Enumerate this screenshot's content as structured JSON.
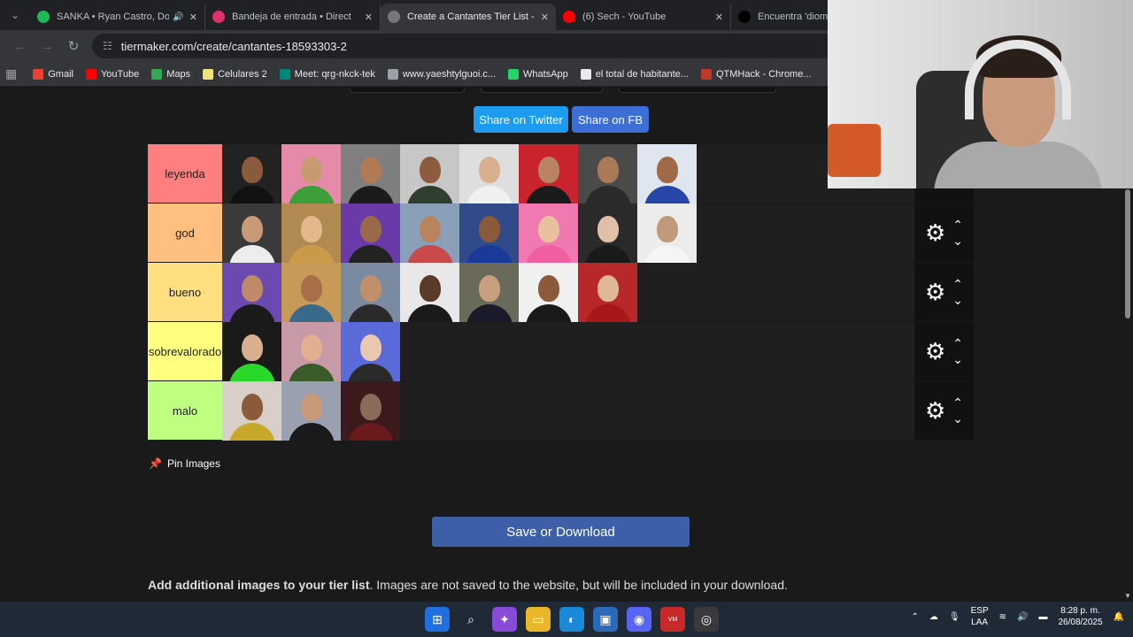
{
  "tabs": [
    {
      "title": "SANKA • Ryan Castro, Don",
      "favicon_color": "#1db954",
      "audio": true,
      "active": false
    },
    {
      "title": "Bandeja de entrada • Direct",
      "favicon_color": "#e1306c",
      "audio": false,
      "active": false
    },
    {
      "title": "Create a Cantantes Tier List - Ti",
      "favicon_color": "#777777",
      "audio": false,
      "active": true
    },
    {
      "title": "(6) Sech - YouTube",
      "favicon_color": "#ff0000",
      "audio": false,
      "active": false
    },
    {
      "title": "Encuentra 'diomed",
      "favicon_color": "#000000",
      "audio": false,
      "active": false
    }
  ],
  "address": {
    "url": "tiermaker.com/create/cantantes-18593303-2"
  },
  "bookmarks": [
    {
      "label": "Gmail",
      "color": "#ea4335"
    },
    {
      "label": "YouTube",
      "color": "#ff0000"
    },
    {
      "label": "Maps",
      "color": "#34a853"
    },
    {
      "label": "Celulares 2",
      "color": "#f1e27a"
    },
    {
      "label": "Meet: qrg-nkck-tek",
      "color": "#00897b"
    },
    {
      "label": "www.yaeshtylguoi.c...",
      "color": "#9aa0a6"
    },
    {
      "label": "WhatsApp",
      "color": "#25d366"
    },
    {
      "label": "el total de habitante...",
      "color": "#e8eaed"
    },
    {
      "label": "QTMHack - Chrome...",
      "color": "#c0392b"
    }
  ],
  "share": {
    "twitter": "Share on Twitter",
    "facebook": "Share on FB"
  },
  "tiers": [
    {
      "label": "leyenda",
      "color": "#ff7f7f",
      "items": [
        {
          "bg": "#222222",
          "skin": "#8a5a3c",
          "shirt": "#111111"
        },
        {
          "bg": "#e58aa8",
          "skin": "#c89a70",
          "shirt": "#3c9f3a"
        },
        {
          "bg": "#7f7f7f",
          "skin": "#b07a55",
          "shirt": "#1b1b1b"
        },
        {
          "bg": "#c7c7c7",
          "skin": "#8d5c3e",
          "shirt": "#2f3f2f"
        },
        {
          "bg": "#dedede",
          "skin": "#d8b090",
          "shirt": "#f0f0f0"
        },
        {
          "bg": "#c9242d",
          "skin": "#b98462",
          "shirt": "#1a1a1a"
        },
        {
          "bg": "#4a4a4a",
          "skin": "#a87a58",
          "shirt": "#2a2a2a"
        },
        {
          "bg": "#dfe6f0",
          "skin": "#a06a48",
          "shirt": "#2845a8"
        }
      ]
    },
    {
      "label": "god",
      "color": "#ffbf7f",
      "items": [
        {
          "bg": "#3a3a3a",
          "skin": "#c89a78",
          "shirt": "#ededed"
        },
        {
          "bg": "#b08a50",
          "skin": "#e3b98c",
          "shirt": "#c89a4a"
        },
        {
          "bg": "#6a3aa8",
          "skin": "#9a6a48",
          "shirt": "#222222"
        },
        {
          "bg": "#8aa0b8",
          "skin": "#b8845e",
          "shirt": "#c84a4a"
        },
        {
          "bg": "#304a8a",
          "skin": "#8a5a3a",
          "shirt": "#1a3a9a"
        },
        {
          "bg": "#f07ab0",
          "skin": "#e8c0a0",
          "shirt": "#f060a0"
        },
        {
          "bg": "#2a2a2a",
          "skin": "#e0c0a8",
          "shirt": "#1a1a1a"
        },
        {
          "bg": "#ececec",
          "skin": "#c09a7a",
          "shirt": "#f5f5f5"
        }
      ]
    },
    {
      "label": "bueno",
      "color": "#ffdf7f",
      "items": [
        {
          "bg": "#6a4ab0",
          "skin": "#c08a68",
          "shirt": "#1a1a1a"
        },
        {
          "bg": "#c89a58",
          "skin": "#a87048",
          "shirt": "#3a6a8a"
        },
        {
          "bg": "#7a8aa0",
          "skin": "#c0906a",
          "shirt": "#2a2a2a"
        },
        {
          "bg": "#e8e8e8",
          "skin": "#5a3a28",
          "shirt": "#1a1a1a"
        },
        {
          "bg": "#6a6a5a",
          "skin": "#c8a080",
          "shirt": "#1a1a2a"
        },
        {
          "bg": "#f0f0f0",
          "skin": "#8a5a3a",
          "shirt": "#1a1a1a"
        },
        {
          "bg": "#b82828",
          "skin": "#e0b898",
          "shirt": "#a81818"
        }
      ]
    },
    {
      "label": "sobrevalorado",
      "color": "#ffff7f",
      "items": [
        {
          "bg": "#1a1a1a",
          "skin": "#d8b090",
          "shirt": "#2ad82a"
        },
        {
          "bg": "#c89aa8",
          "skin": "#e0b090",
          "shirt": "#3a5a2a"
        },
        {
          "bg": "#5a6ad8",
          "skin": "#e8c8b0",
          "shirt": "#2a2a2a"
        }
      ]
    },
    {
      "label": "malo",
      "color": "#bfff7f",
      "items": [
        {
          "bg": "#d8d0c8",
          "skin": "#8a5a3a",
          "shirt": "#c8a82a"
        },
        {
          "bg": "#9aa0b0",
          "skin": "#c89a78",
          "shirt": "#1a1a1a"
        },
        {
          "bg": "#3a1a1a",
          "skin": "#8a6a58",
          "shirt": "#6a1a1a"
        }
      ]
    }
  ],
  "pin": {
    "label": "Pin Images"
  },
  "save": {
    "label": "Save or Download"
  },
  "add": {
    "bold": "Add additional images to your tier list",
    "rest": ". Images are not saved to the website, but will be included in your download."
  },
  "taskbar": {
    "lang_1": "ESP",
    "lang_2": "LAA",
    "time": "8:28 p. m.",
    "date": "26/08/2025"
  }
}
